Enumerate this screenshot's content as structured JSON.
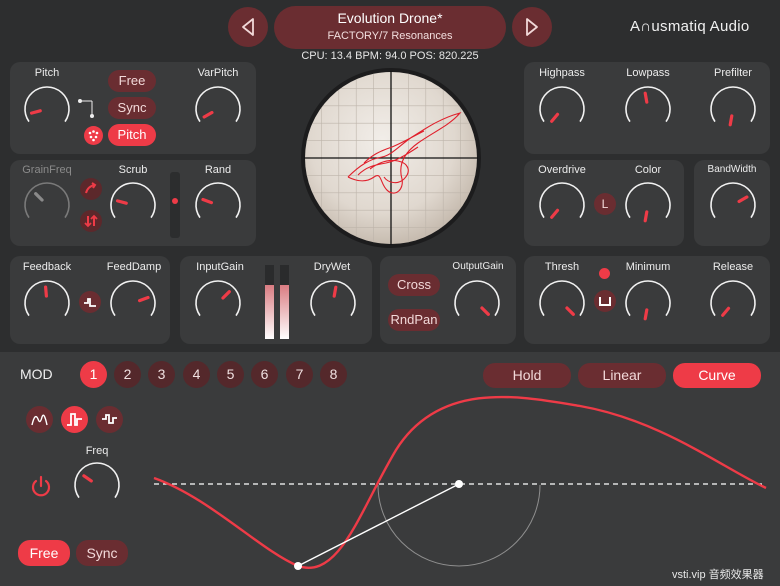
{
  "header": {
    "preset_name": "Evolution Drone*",
    "preset_bank": "FACTORY/7 Resonances",
    "status_line": "CPU: 13.4 BPM: 94.0 POS: 820.225",
    "brand": "A∩usmatiq Audio",
    "prev_icon": "triangle-left-icon",
    "next_icon": "triangle-right-icon"
  },
  "grain": {
    "pitch_label": "Pitch",
    "varpitch_label": "VarPitch",
    "mode_buttons": [
      "Free",
      "Sync",
      "Pitch"
    ],
    "mode_selected": "Pitch",
    "grainfreq_label": "GrainFreq",
    "scrub_label": "Scrub",
    "rand_label": "Rand"
  },
  "feedback": {
    "feedback_label": "Feedback",
    "feeddamp_label": "FeedDamp"
  },
  "io": {
    "inputgain_label": "InputGain",
    "drywet_label": "DryWet",
    "cross_label": "Cross",
    "rndpan_label": "RndPan",
    "outputgain_label": "OutputGain"
  },
  "filter": {
    "highpass_label": "Highpass",
    "lowpass_label": "Lowpass",
    "prefilter_label": "Prefilter",
    "overdrive_label": "Overdrive",
    "color_label": "Color",
    "l_button": "L",
    "bandwidth_label": "BandWidth"
  },
  "dynamics": {
    "thresh_label": "Thresh",
    "minimum_label": "Minimum",
    "release_label": "Release"
  },
  "mod": {
    "title": "MOD",
    "slots": [
      "1",
      "2",
      "3",
      "4",
      "5",
      "6",
      "7",
      "8"
    ],
    "selected_slot": "1",
    "interp_buttons": [
      "Hold",
      "Linear",
      "Curve"
    ],
    "interp_selected": "Curve",
    "freq_label": "Freq",
    "rate_buttons": [
      "Free",
      "Sync"
    ],
    "rate_selected": "Free"
  },
  "footer": {
    "watermark": "vsti.vip 音频效果器"
  },
  "colors": {
    "accent": "#ee3b47",
    "accent_dark": "#6a2d31",
    "panel": "#3a3b3c",
    "background": "#2d2e2f"
  }
}
